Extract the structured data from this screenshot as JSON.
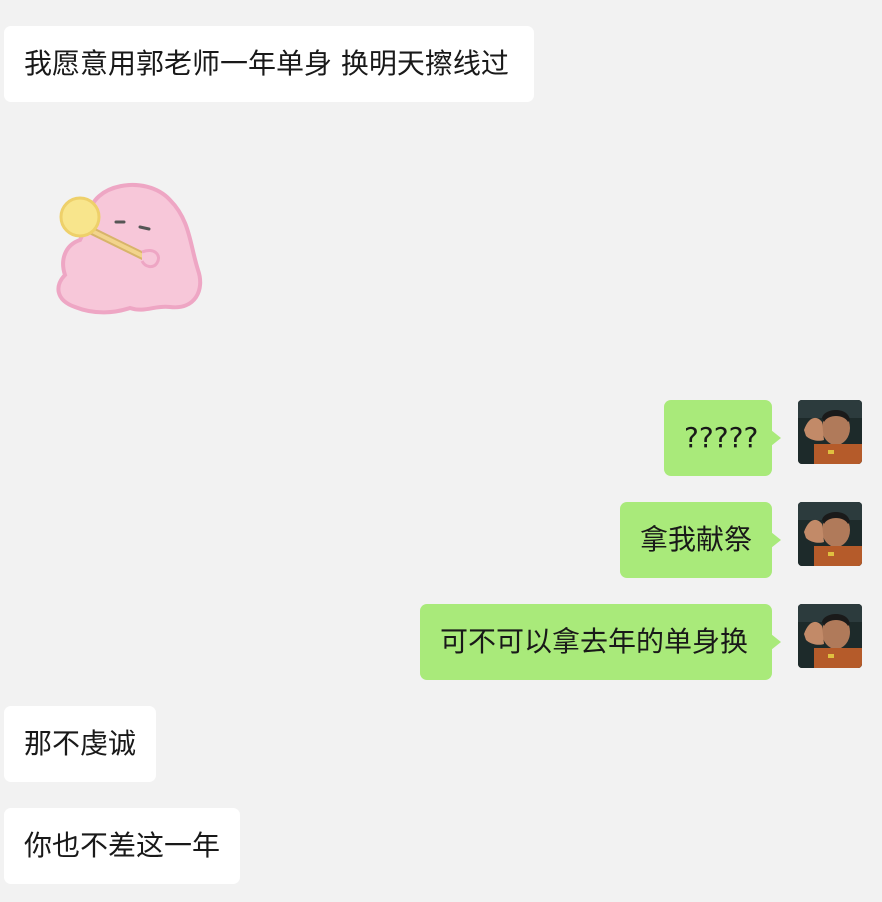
{
  "chat": {
    "messages": [
      {
        "side": "in",
        "type": "text",
        "text": "我愿意用郭老师一年单身 换明天擦线过"
      },
      {
        "side": "in",
        "type": "sticker",
        "sticker": "pink-blob-holding-lollipop-sticker"
      },
      {
        "side": "out",
        "type": "text",
        "text": "?????"
      },
      {
        "side": "out",
        "type": "text",
        "text": "拿我献祭"
      },
      {
        "side": "out",
        "type": "text",
        "text": "可不可以拿去年的单身换"
      },
      {
        "side": "in",
        "type": "text",
        "text": "那不虔诚"
      },
      {
        "side": "in",
        "type": "text",
        "text": "你也不差这一年"
      }
    ]
  },
  "colors": {
    "background": "#f2f2f2",
    "incoming_bubble": "#ffffff",
    "outgoing_bubble": "#a9ea7a",
    "text": "#191919"
  },
  "icons": {
    "self_avatar": "man-covering-ear-avatar",
    "sticker": "pink-blob-holding-lollipop-sticker"
  }
}
